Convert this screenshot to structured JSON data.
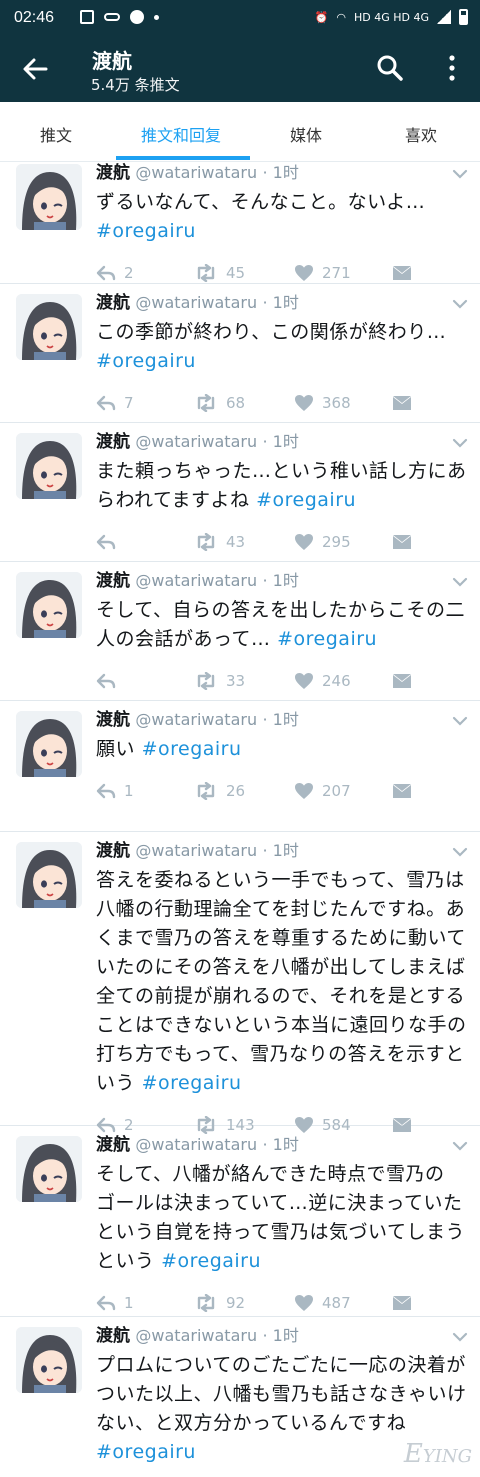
{
  "status_bar": {
    "time": "02:46",
    "network": "HD 4G HD 4G"
  },
  "app_bar": {
    "title": "渡航",
    "subtitle": "5.4万 条推文"
  },
  "tabs": [
    {
      "label": "推文"
    },
    {
      "label": "推文和回复",
      "active": true
    },
    {
      "label": "媒体"
    },
    {
      "label": "喜欢"
    }
  ],
  "colors": {
    "header": "#10343f",
    "accent": "#1da1f2",
    "hashtag": "#1d91da",
    "muted": "#aab8c2"
  },
  "tweets": [
    {
      "name": "渡航",
      "handle": "@watariwataru",
      "time": "· 1时",
      "lines": [
        "ずるいなんて、そんなこと。ないよ…"
      ],
      "hashtag": "#oregairu",
      "replies": "2",
      "retweets": "45",
      "likes": "271"
    },
    {
      "name": "渡航",
      "handle": "@watariwataru",
      "time": "· 1时",
      "lines": [
        "この季節が終わり、この関係が終わり…"
      ],
      "hashtag": "#oregairu",
      "replies": "7",
      "retweets": "68",
      "likes": "368"
    },
    {
      "name": "渡航",
      "handle": "@watariwataru",
      "time": "· 1时",
      "lines": [
        "また頼っちゃった…という稚い話し方にあ",
        "らわれてますよね"
      ],
      "hashtag": "#oregairu",
      "replies": "",
      "retweets": "43",
      "likes": "295"
    },
    {
      "name": "渡航",
      "handle": "@watariwataru",
      "time": "· 1时",
      "lines": [
        "そして、自らの答えを出したからこその二",
        "人の会話があって…"
      ],
      "hashtag": "#oregairu",
      "replies": "",
      "retweets": "33",
      "likes": "246"
    },
    {
      "name": "渡航",
      "handle": "@watariwataru",
      "time": "· 1时",
      "lines": [
        "願い"
      ],
      "hashtag": "#oregairu",
      "replies": "1",
      "retweets": "26",
      "likes": "207"
    },
    {
      "name": "渡航",
      "handle": "@watariwataru",
      "time": "· 1时",
      "lines": [
        "答えを委ねるという一手でもって、雪乃は",
        "八幡の行動理論全てを封じたんですね。あ",
        "くまで雪乃の答えを尊重するために動いて",
        "いたのにその答えを八幡が出してしまえば",
        "全ての前提が崩れるので、それを是とする",
        "ことはできないという本当に遠回りな手の",
        "打ち方でもって、雪乃なりの答えを示すと",
        "いう"
      ],
      "hashtag": "#oregairu",
      "replies": "2",
      "retweets": "143",
      "likes": "584"
    },
    {
      "name": "渡航",
      "handle": "@watariwataru",
      "time": "· 1时",
      "lines": [
        "そして、八幡が絡んできた時点で雪乃の",
        "ゴールは決まっていて…逆に決まっていた",
        "という自覚を持って雪乃は気づいてしまう",
        "という"
      ],
      "hashtag": "#oregairu",
      "replies": "1",
      "retweets": "92",
      "likes": "487"
    },
    {
      "name": "渡航",
      "handle": "@watariwataru",
      "time": "· 1时",
      "lines": [
        "プロムについてのごたごたに一応の決着が",
        "ついた以上、八幡も雪乃も話さなきゃいけ",
        "ない、と双方分かっているんですね"
      ],
      "hashtag": "#oregairu",
      "replies": "",
      "retweets": "",
      "likes": ""
    }
  ],
  "watermark": "EYING"
}
